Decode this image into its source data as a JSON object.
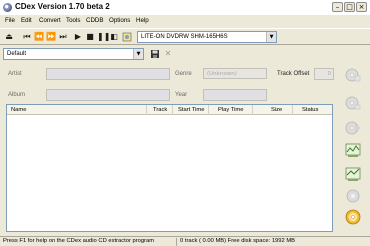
{
  "window": {
    "title": "CDex Version 1.70 beta 2"
  },
  "menu": [
    "File",
    "Edit",
    "Convert",
    "Tools",
    "CDDB",
    "Options",
    "Help"
  ],
  "toolbar": {
    "drive": "LITE-ON DVDRW SHM-165H6S"
  },
  "profile": {
    "value": "Default"
  },
  "fields": {
    "artist_label": "Artist",
    "album_label": "Album",
    "genre_label": "Genre",
    "genre_value": "(Unknown)",
    "year_label": "Year",
    "track_offset_label": "Track Offset",
    "track_offset_value": "0"
  },
  "list": {
    "columns": [
      "Name",
      "Track",
      "Start Time",
      "Play Time",
      "Size",
      "Status"
    ]
  },
  "status": {
    "left": "Press F1 for help on the CDex audio CD extractor program",
    "right": "0 track ( 0.00 MB) Free disk space: 1992 MB"
  }
}
